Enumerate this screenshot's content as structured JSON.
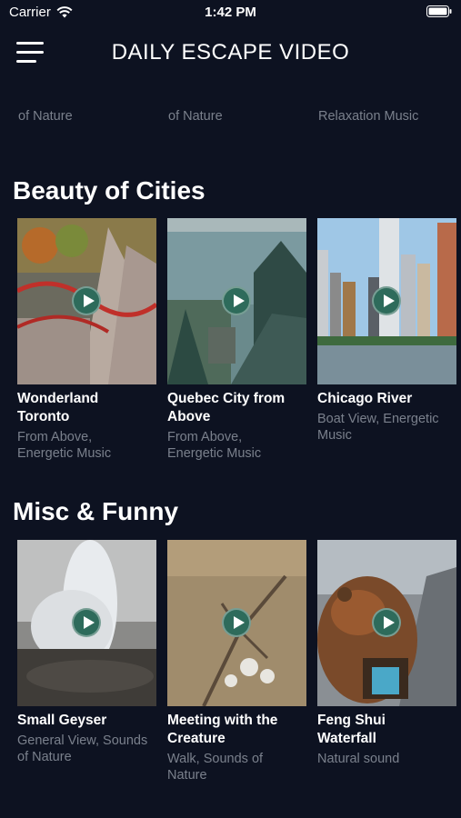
{
  "status_bar": {
    "carrier": "Carrier",
    "time": "1:42 PM"
  },
  "header": {
    "title": "DAILY ESCAPE VIDEO"
  },
  "partial_row": [
    "of Nature",
    "of Nature",
    "Relaxation Music"
  ],
  "sections": [
    {
      "title": "Beauty of Cities",
      "videos": [
        {
          "title_line1": "Wonderland",
          "title_line2": "Toronto",
          "sub_line1": "From Above,",
          "sub_line2": "Energetic Music"
        },
        {
          "title_line1": "Quebec City from",
          "title_line2": "Above",
          "sub_line1": "From Above,",
          "sub_line2": "Energetic Music"
        },
        {
          "title_line1": "Chicago River",
          "title_line2": "",
          "sub_line1": "Boat View, Energetic",
          "sub_line2": "Music"
        }
      ]
    },
    {
      "title": "Misc & Funny",
      "videos": [
        {
          "title_line1": "Small Geyser",
          "title_line2": "",
          "sub_line1": "General View, Sounds",
          "sub_line2": "of Nature"
        },
        {
          "title_line1": "Meeting with the",
          "title_line2": "Creature",
          "sub_line1": "Walk, Sounds of",
          "sub_line2": "Nature"
        },
        {
          "title_line1": "Feng Shui",
          "title_line2": "Waterfall",
          "sub_line1": "Natural sound",
          "sub_line2": ""
        }
      ]
    }
  ],
  "icons": {
    "menu": "hamburger-menu-icon",
    "play": "play-icon",
    "wifi": "wifi-icon",
    "battery": "battery-icon"
  },
  "colors": {
    "background": "#0d1221",
    "play_button": "#2e6b5b",
    "subtitle": "#7a808c"
  }
}
